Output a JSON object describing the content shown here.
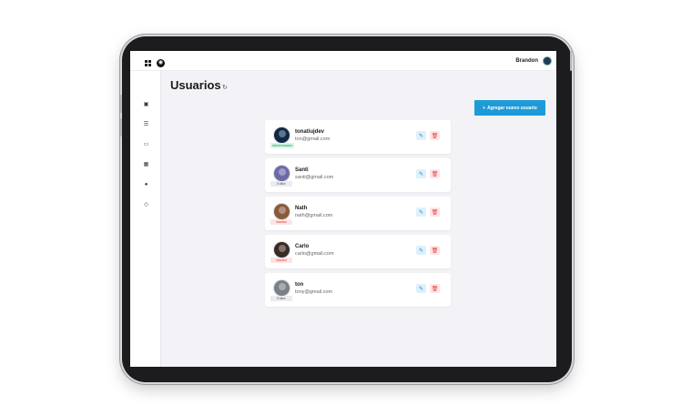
{
  "header": {
    "user_name": "Brandon",
    "logo_glyph": "◉"
  },
  "sidebar": {
    "items": [
      {
        "icon": "dashboard-icon",
        "glyph": "▣"
      },
      {
        "icon": "list-icon",
        "glyph": "☰"
      },
      {
        "icon": "image-icon",
        "glyph": "▭"
      },
      {
        "icon": "apps-icon",
        "glyph": "▦"
      },
      {
        "icon": "user-circle-icon",
        "glyph": "●"
      },
      {
        "icon": "tag-icon",
        "glyph": "◇"
      }
    ]
  },
  "main": {
    "title": "Usuarios",
    "refresh_glyph": "↻",
    "add_button": {
      "icon": "+",
      "label": "Agregar nuevo usuario"
    }
  },
  "users": [
    {
      "name": "tonatiujdev",
      "email": "ton@gmail.com",
      "role": "Administrador",
      "role_bg": "#d9f7e6",
      "role_fg": "#159a58",
      "avatar_color": "#0f2a47"
    },
    {
      "name": "Santi",
      "email": "santi@gmail.com",
      "role": "Editor",
      "role_bg": "#ececf0",
      "role_fg": "#555555",
      "avatar_color": "#6d6aa8"
    },
    {
      "name": "Nath",
      "email": "nath@gmail.com",
      "role": "Inactivo",
      "role_bg": "#fde4e4",
      "role_fg": "#d53b3b",
      "avatar_color": "#8a5a3c"
    },
    {
      "name": "Carlo",
      "email": "carlo@gmail.com",
      "role": "Inactivo",
      "role_bg": "#fde4e4",
      "role_fg": "#d53b3b",
      "avatar_color": "#3a2b24"
    },
    {
      "name": "ton",
      "email": "tony@gmail.com",
      "role": "Editor",
      "role_bg": "#ececf0",
      "role_fg": "#555555",
      "avatar_color": "#7b7f86"
    }
  ],
  "actions": {
    "edit_glyph": "✎",
    "delete_glyph": "🗑"
  }
}
